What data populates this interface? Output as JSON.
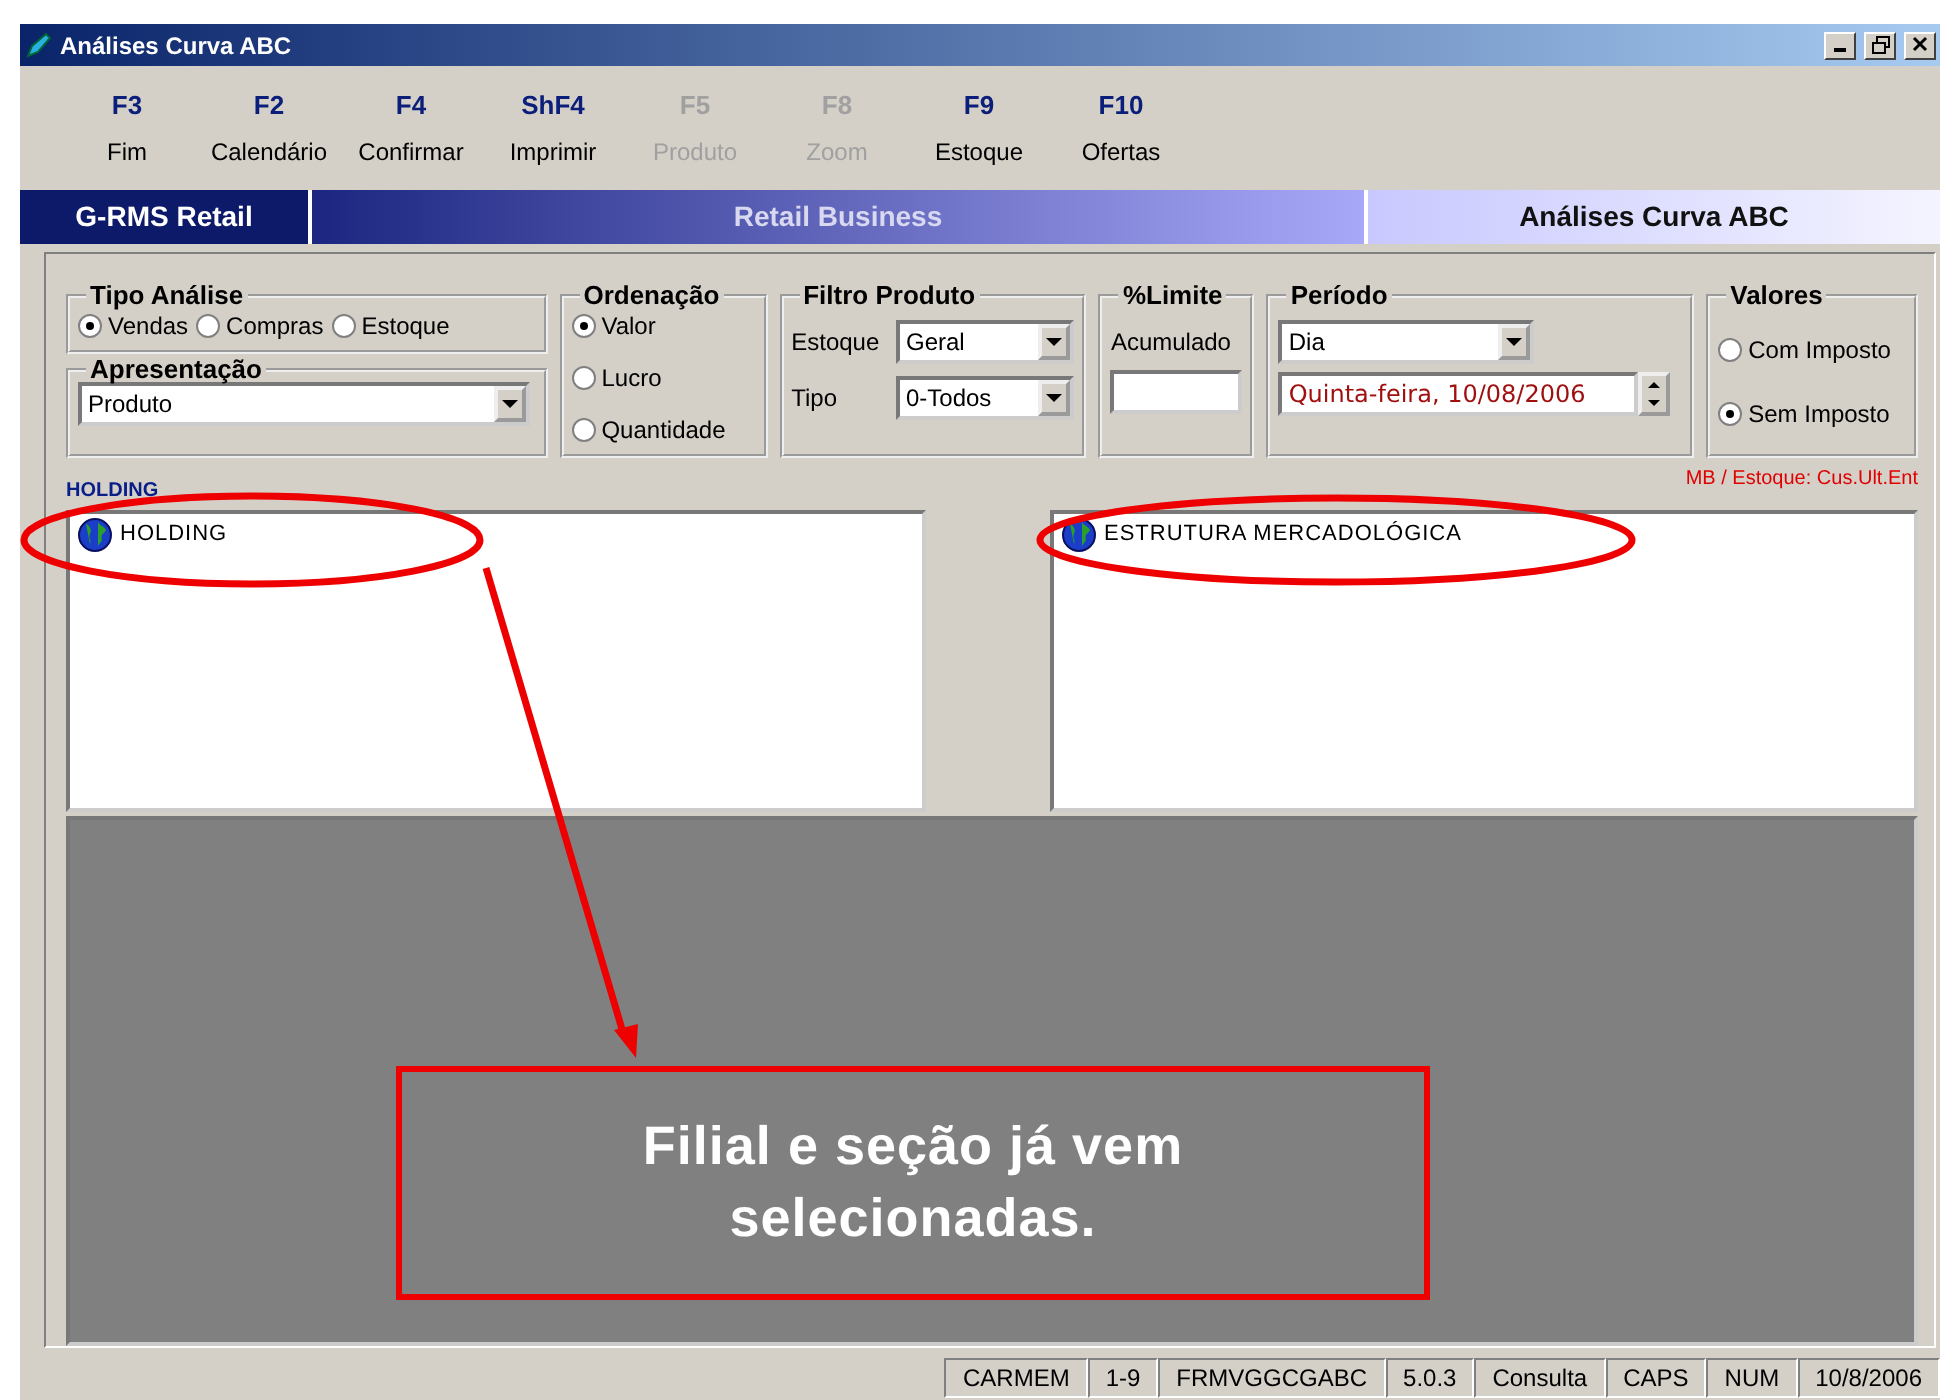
{
  "window": {
    "title": "Análises Curva ABC"
  },
  "toolbar": [
    {
      "key": "F3",
      "label": "Fim",
      "disabled": false
    },
    {
      "key": "F2",
      "label": "Calendário",
      "disabled": false
    },
    {
      "key": "F4",
      "label": "Confirmar",
      "disabled": false
    },
    {
      "key": "ShF4",
      "label": "Imprimir",
      "disabled": false
    },
    {
      "key": "F5",
      "label": "Produto",
      "disabled": true
    },
    {
      "key": "F8",
      "label": "Zoom",
      "disabled": true
    },
    {
      "key": "F9",
      "label": "Estoque",
      "disabled": false
    },
    {
      "key": "F10",
      "label": "Ofertas",
      "disabled": false
    }
  ],
  "banner": {
    "brand": "G-RMS Retail",
    "center": "Retail Business",
    "screen": "Análises Curva ABC"
  },
  "tipo_analise": {
    "title": "Tipo Análise",
    "options": [
      {
        "label": "Vendas",
        "selected": true
      },
      {
        "label": "Compras",
        "selected": false
      },
      {
        "label": "Estoque",
        "selected": false
      }
    ]
  },
  "apresentacao": {
    "title": "Apresentação",
    "value": "Produto"
  },
  "ordenacao": {
    "title": "Ordenação",
    "options": [
      {
        "label": "Valor",
        "selected": true
      },
      {
        "label": "Lucro",
        "selected": false
      },
      {
        "label": "Quantidade",
        "selected": false
      }
    ]
  },
  "filtro_produto": {
    "title": "Filtro Produto",
    "fields": [
      {
        "label": "Estoque",
        "value": "Geral"
      },
      {
        "label": "Tipo",
        "value": "0-Todos"
      }
    ]
  },
  "limite": {
    "title": "%Limite",
    "label": "Acumulado"
  },
  "periodo": {
    "title": "Período",
    "value": "Dia",
    "date": "Quinta-feira, 10/08/2006"
  },
  "valores": {
    "title": "Valores",
    "options": [
      {
        "label": "Com Imposto",
        "selected": false
      },
      {
        "label": "Sem Imposto",
        "selected": true
      }
    ]
  },
  "holding_label": "HOLDING",
  "note": "MB / Estoque: Cus.Ult.Ent",
  "trees": [
    {
      "items": [
        {
          "label": "HOLDING"
        }
      ]
    },
    {
      "items": [
        {
          "label": "ESTRUTURA MERCADOLÓGICA"
        }
      ]
    }
  ],
  "callout": "Filial e seção já vem selecionadas.",
  "status_bar": [
    "CARMEM",
    "1-9",
    "FRMVGGCGABC",
    "5.0.3",
    "Consulta",
    "CAPS",
    "NUM",
    "10/8/2006"
  ]
}
